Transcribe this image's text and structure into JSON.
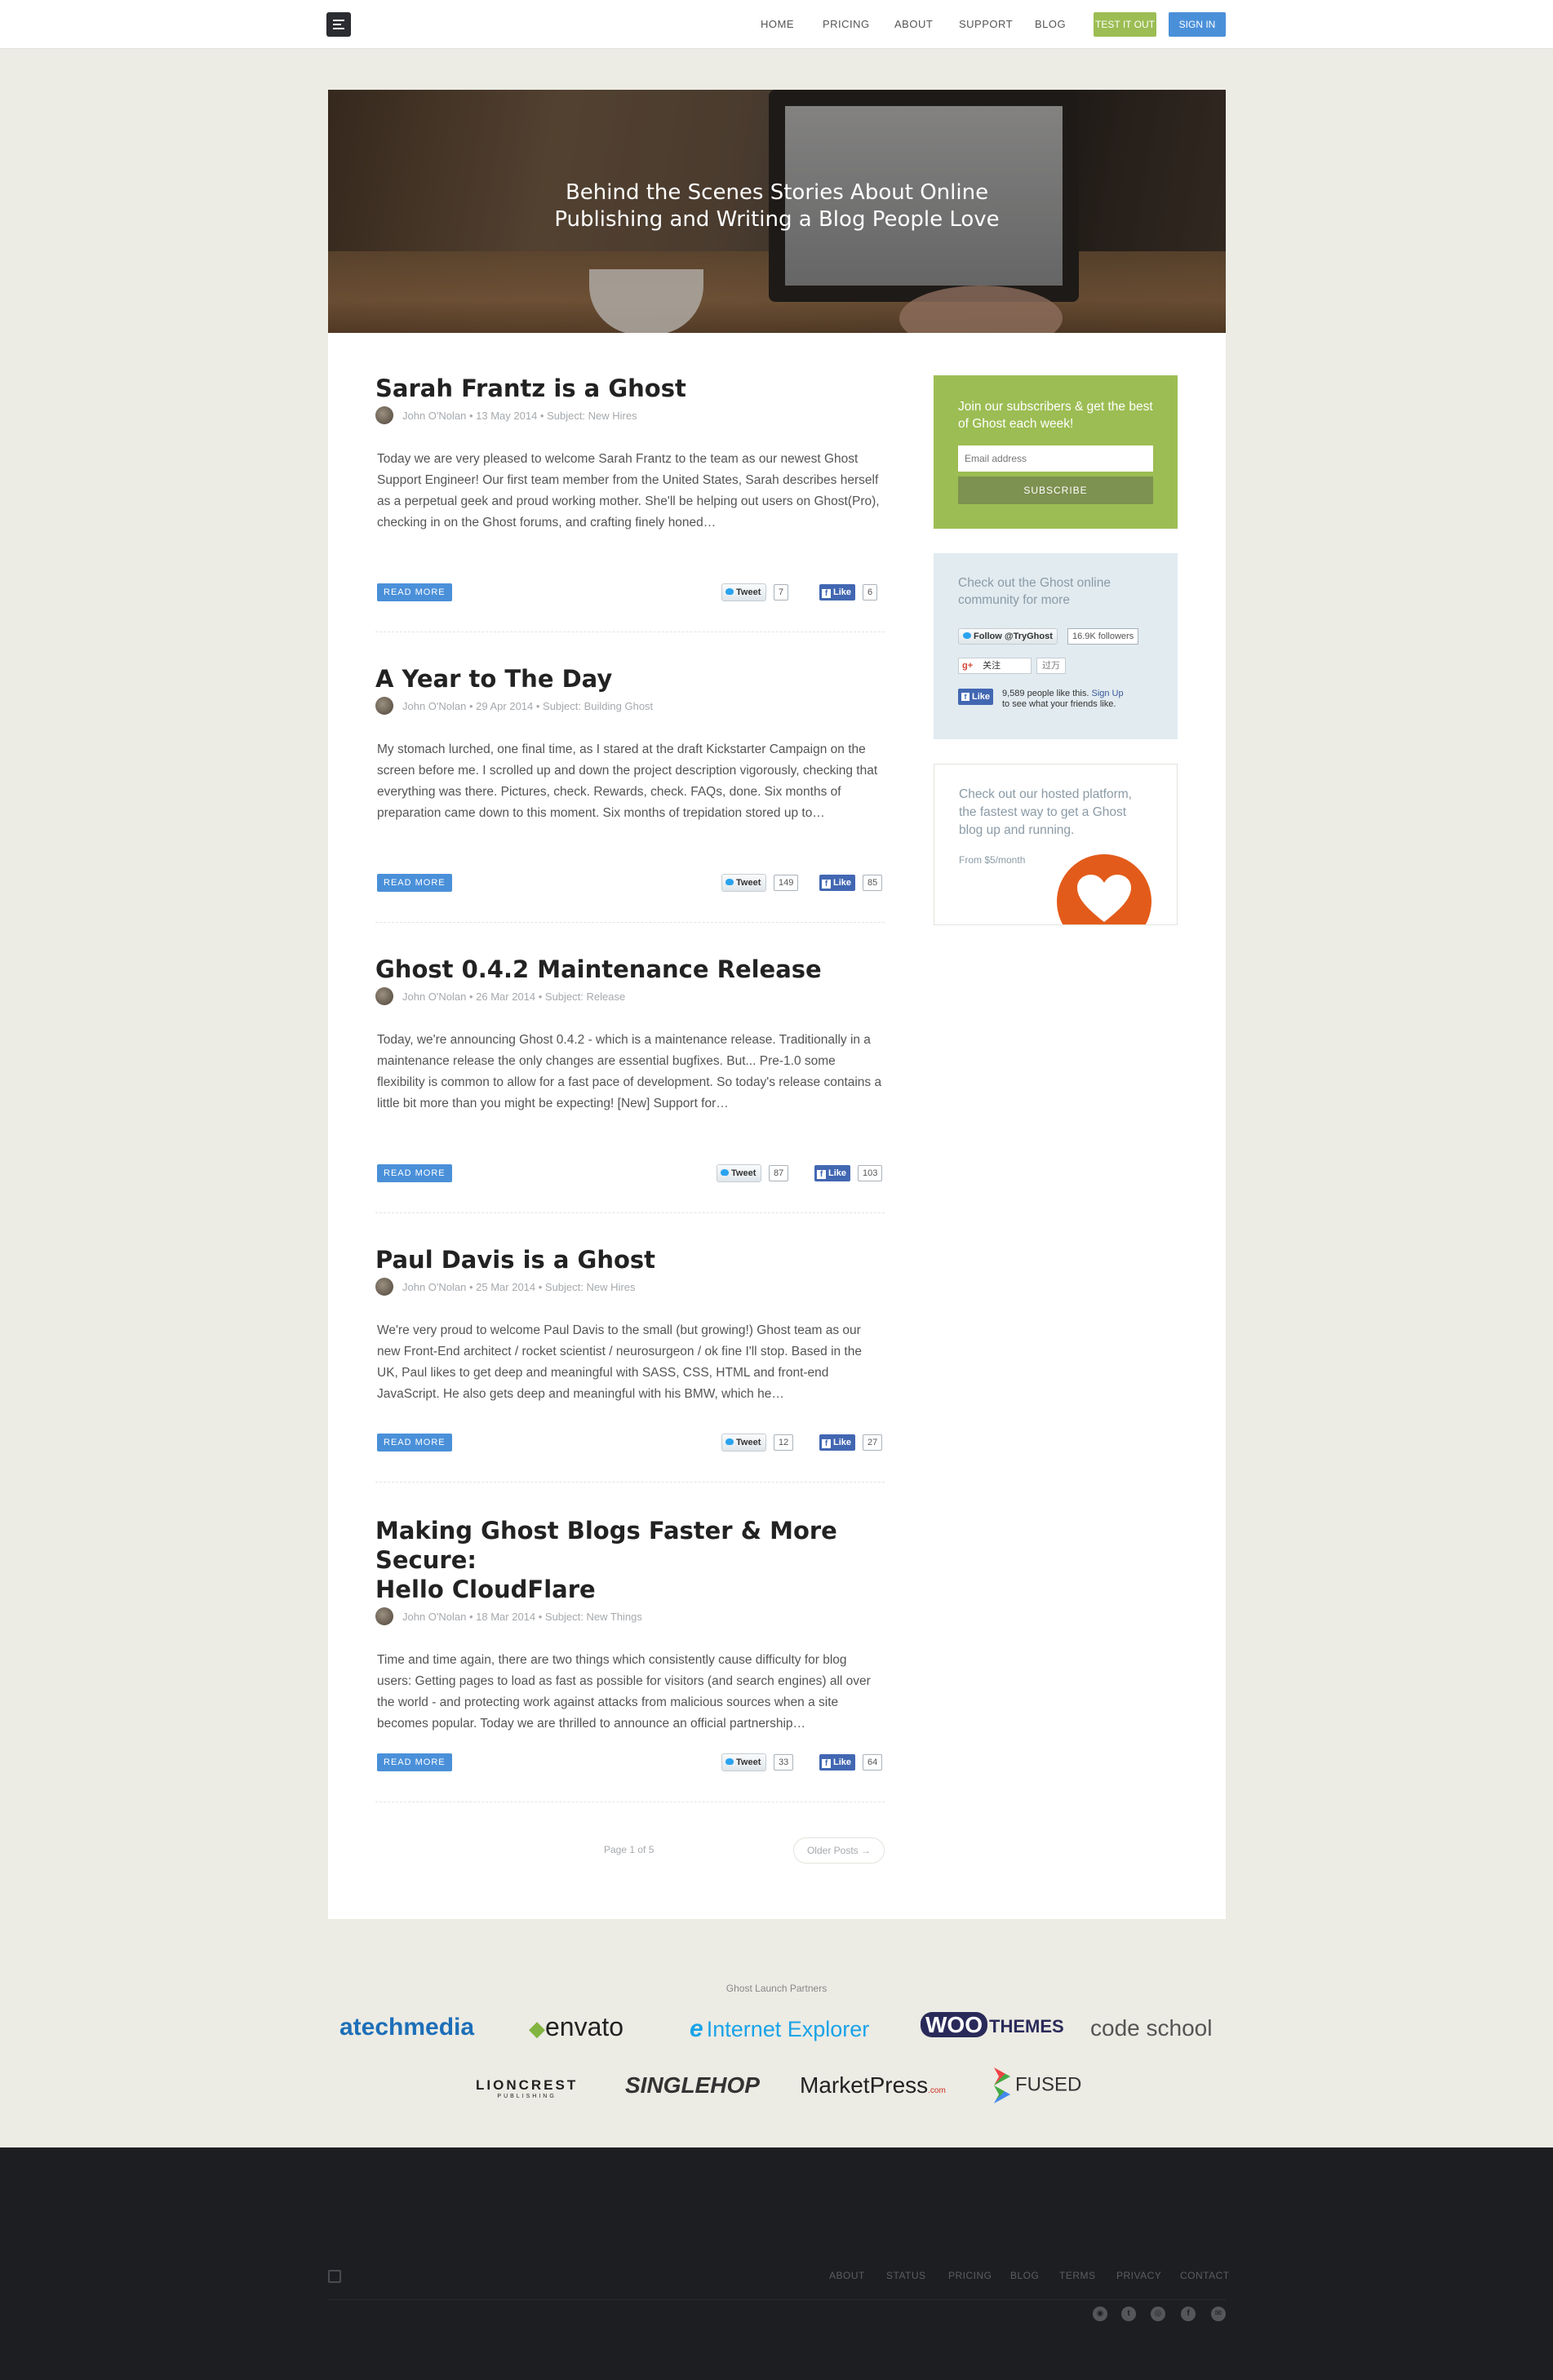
{
  "nav": {
    "items": [
      "HOME",
      "PRICING",
      "ABOUT",
      "SUPPORT",
      "BLOG"
    ],
    "test_label": "TEST IT OUT",
    "signin_label": "SIGN IN"
  },
  "hero": {
    "title_line1": "Behind the Scenes Stories About Online",
    "title_line2": "Publishing and Writing a Blog People Love"
  },
  "posts": [
    {
      "title": "Sarah Frantz is a Ghost",
      "meta": "John O'Nolan • 13 May 2014 • Subject: New Hires",
      "excerpt": "Today we are very pleased to welcome Sarah Frantz to the team as our newest Ghost Support Engineer! Our first team member from the United States, Sarah describes herself as a perpetual geek and proud working mother. She'll be helping out users on Ghost(Pro), checking in on the Ghost forums, and crafting finely honed…",
      "read_more": "READ MORE",
      "tweet": "Tweet",
      "tweet_count": "7",
      "like": "Like",
      "like_count": "6"
    },
    {
      "title": "A Year to The Day",
      "meta": "John O'Nolan • 29 Apr 2014 • Subject: Building Ghost",
      "excerpt": "My stomach lurched, one final time, as I stared at the draft Kickstarter Campaign on the screen before me. I scrolled up and down the project description vigorously, checking that everything was there. Pictures, check. Rewards, check. FAQs, done. Six months of preparation came down to this moment. Six months of trepidation stored up to…",
      "read_more": "READ MORE",
      "tweet": "Tweet",
      "tweet_count": "149",
      "like": "Like",
      "like_count": "85"
    },
    {
      "title": "Ghost 0.4.2 Maintenance Release",
      "meta": "John O'Nolan • 26 Mar 2014 • Subject: Release",
      "excerpt": "Today, we're announcing Ghost 0.4.2 - which is a maintenance release. Traditionally in a maintenance release the only changes are essential bugfixes. But... Pre-1.0 some flexibility is common to allow for a fast pace of development. So today's release contains a little bit more than you might be expecting! [New] Support for…",
      "read_more": "READ MORE",
      "tweet": "Tweet",
      "tweet_count": "87",
      "like": "Like",
      "like_count": "103"
    },
    {
      "title": "Paul Davis is a Ghost",
      "meta": "John O'Nolan • 25 Mar 2014 • Subject: New Hires",
      "excerpt": "We're very proud to welcome Paul Davis to the small (but growing!) Ghost team as our new Front-End architect / rocket scientist / neurosurgeon / ok fine I'll stop. Based in the UK, Paul likes to get deep and meaningful with SASS, CSS, HTML and front-end JavaScript. He also gets deep and meaningful with his BMW, which he…",
      "read_more": "READ MORE",
      "tweet": "Tweet",
      "tweet_count": "12",
      "like": "Like",
      "like_count": "27"
    },
    {
      "title_line1": "Making Ghost Blogs Faster & More Secure:",
      "title_line2": "Hello CloudFlare",
      "meta": "John O'Nolan • 18 Mar 2014 • Subject: New Things",
      "excerpt": "Time and time again, there are two things which consistently cause difficulty for blog users: Getting pages to load as fast as possible for visitors (and search engines) all over the world - and protecting work against attacks from malicious sources when a site becomes popular. Today we are thrilled to announce an official partnership…",
      "read_more": "READ MORE",
      "tweet": "Tweet",
      "tweet_count": "33",
      "like": "Like",
      "like_count": "64"
    }
  ],
  "pager": {
    "label": "Page 1 of 5",
    "older": "Older Posts →"
  },
  "sidebar": {
    "subscribe_text": "Join our subscribers & get the best of Ghost each week!",
    "email_placeholder": "Email address",
    "subscribe_button": "SUBSCRIBE",
    "community_text": "Check out the Ghost online community for more",
    "follow_label": "Follow @TryGhost",
    "follow_count": "16.9K followers",
    "gplus_label": "关注",
    "gplus_count": "过万",
    "fb_like": "Like",
    "fb_like_text": "9,589 people like this.",
    "fb_signup": "Sign Up",
    "fb_like_text2": "to see what your friends like.",
    "hosted_text": "Check out our hosted platform, the fastest way to get a Ghost blog up and running.",
    "hosted_price": "From $5/month"
  },
  "partners": {
    "label": "Ghost Launch Partners",
    "logos": [
      "atechmedia",
      "envato",
      "Internet Explorer",
      "WOO",
      "THEMES",
      "code school",
      "LIONCREST",
      "PUBLISHING",
      "SINGLEHOP",
      "MarketPress",
      ".com",
      "FUSED"
    ]
  },
  "footer": {
    "links": [
      "ABOUT",
      "STATUS",
      "PRICING",
      "BLOG",
      "TERMS",
      "PRIVACY",
      "CONTACT"
    ]
  },
  "colors": {
    "accent_green": "#9cbd53",
    "accent_blue": "#4a90d9",
    "facebook": "#4267b2",
    "footer_bg": "#1d1e22",
    "heart_orange": "#e35b1a"
  }
}
